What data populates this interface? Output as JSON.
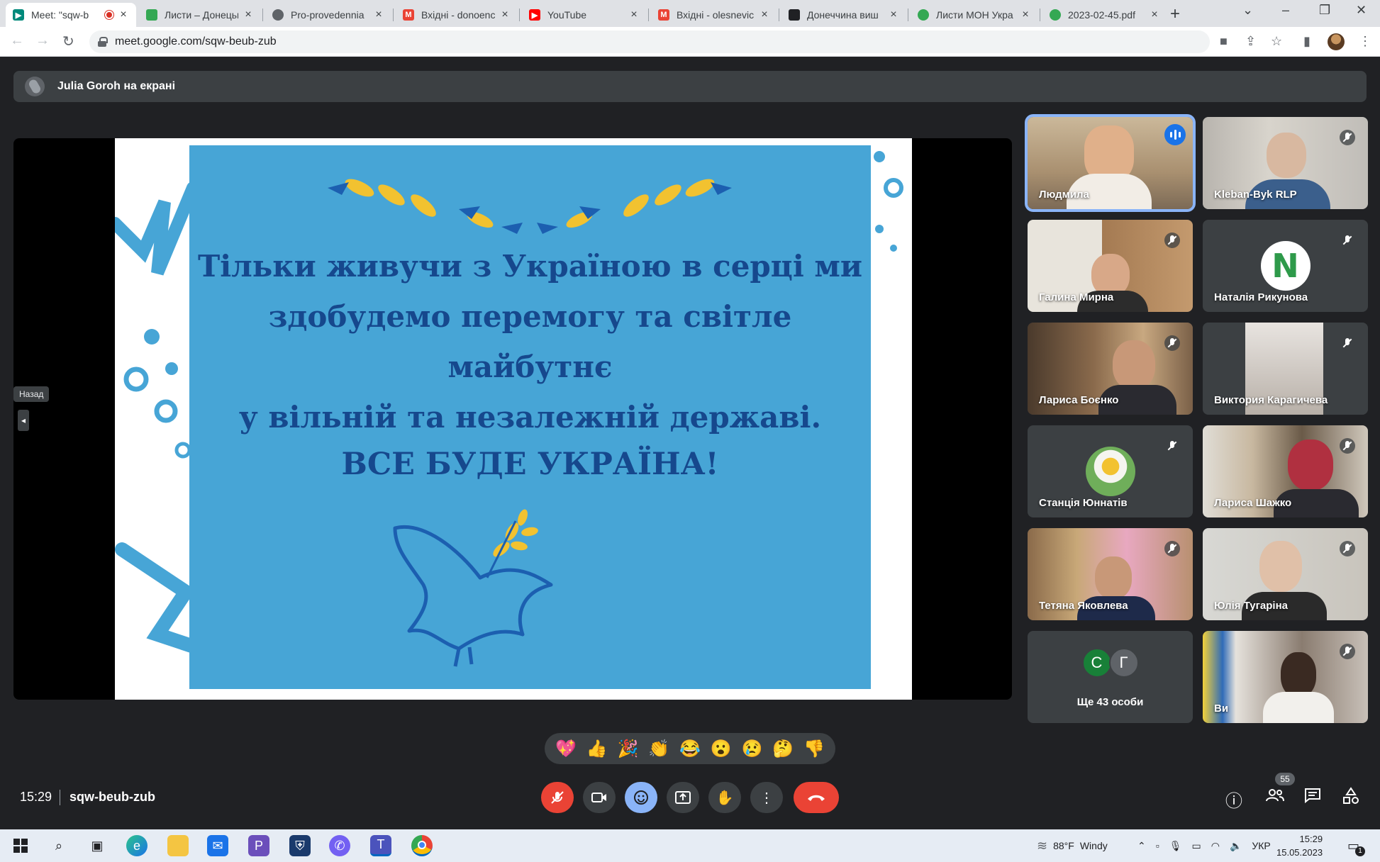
{
  "browser": {
    "tabs": [
      {
        "title": "Meet: \"sqw-b",
        "active": true,
        "icon_color": "#00897b",
        "recording": true
      },
      {
        "title": "Листи – Донецьк",
        "active": false,
        "icon_color": "#34a853"
      },
      {
        "title": "Pro-provedennia",
        "active": false,
        "icon_color": "#5f6368"
      },
      {
        "title": "Вхідні - donoenc",
        "active": false,
        "icon_color": "#ea4335"
      },
      {
        "title": "YouTube",
        "active": false,
        "icon_color": "#ff0000"
      },
      {
        "title": "Вхідні - olesnevic",
        "active": false,
        "icon_color": "#ea4335"
      },
      {
        "title": "Донеччина виш",
        "active": false,
        "icon_color": "#202124"
      },
      {
        "title": "Листи МОН Укра",
        "active": false,
        "icon_color": "#34a853"
      },
      {
        "title": "2023-02-45.pdf",
        "active": false,
        "icon_color": "#34a853"
      }
    ],
    "url": "meet.google.com/sqw-beub-zub"
  },
  "banner": {
    "text": "Julia Goroh на екрані"
  },
  "slide": {
    "quote_lines": [
      "Тільки живучи з Україною в серці ми",
      "здобудемо перемогу та світле майбутнє",
      "у вільній та незалежній державі."
    ],
    "motto": "ВСЕ БУДЕ УКРАЇНА!",
    "back_tooltip": "Назад"
  },
  "participants": [
    {
      "name": "Людмила",
      "speaking": true
    },
    {
      "name": "Kleban-Byk RLP",
      "muted": true
    },
    {
      "name": "Галина Мирна",
      "muted": true
    },
    {
      "name": "Наталія Рикунова",
      "muted": true
    },
    {
      "name": "Лариса Боєнко",
      "muted": true
    },
    {
      "name": "Виктория Карагичева",
      "muted": true
    },
    {
      "name": "Станція Юннатів",
      "muted": true
    },
    {
      "name": "Лариса Шажко",
      "muted": true
    },
    {
      "name": "Тетяна Яковлева",
      "muted": true
    },
    {
      "name": "Юлія Тугаріна",
      "muted": true
    },
    {
      "name": "Ви",
      "muted": true
    }
  ],
  "more_tile": {
    "initials": [
      "С",
      "Г"
    ],
    "label": "Ще 43 особи"
  },
  "reactions": [
    "💖",
    "👍",
    "🎉",
    "👏",
    "😂",
    "😮",
    "😢",
    "🤔",
    "👎"
  ],
  "bottom_bar": {
    "time": "15:29",
    "meeting_code": "sqw-beub-zub",
    "participants_count": "55"
  },
  "taskbar": {
    "weather_temp": "88°F",
    "weather_text": "Windy",
    "language": "УКР",
    "time": "15:29",
    "date": "15.05.2023",
    "notification_count": "1"
  },
  "colors": {
    "accent_blue": "#8ab4f8",
    "danger_red": "#ea4335",
    "slide_blue": "#47a5d6",
    "slide_text": "#16488d",
    "wheat_yellow": "#f2c230"
  }
}
